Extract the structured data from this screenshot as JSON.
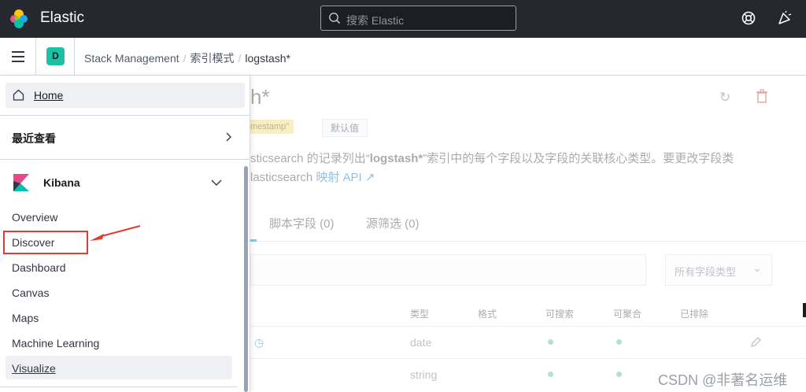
{
  "header": {
    "brand": "Elastic",
    "search_placeholder": "搜索 Elastic"
  },
  "breadcrumbs": {
    "space_initial": "D",
    "items": [
      "Stack Management",
      "索引模式",
      "logstash*"
    ]
  },
  "nav": {
    "home": "Home",
    "recent": "最近查看",
    "section": "Kibana",
    "items": [
      "Overview",
      "Discover",
      "Dashboard",
      "Canvas",
      "Maps",
      "Machine Learning",
      "Visualize"
    ],
    "active_item": "Visualize"
  },
  "background": {
    "title": "h*",
    "badge_timestamp": "mestamp\"",
    "badge_default": "默认值",
    "desc_line1_a": "sticsearch 的记录列出“",
    "desc_line1_b": "logstash*",
    "desc_line1_c": "”索引中的每个字段以及字段的关联核心类型。要更改字段类",
    "desc_line2_a": "lasticsearch ",
    "desc_line2_link": "映射 API",
    "tab_script": "脚本字段 (0)",
    "tab_source": "源筛选 (0)",
    "type_filter": "所有字段类型",
    "columns": [
      "类型",
      "格式",
      "可搜索",
      "可聚合",
      "已排除"
    ],
    "rows": [
      {
        "type": "date"
      },
      {
        "type": "string"
      }
    ]
  },
  "watermark": "CSDN @非著名运维",
  "colors": {
    "header_bg": "#25282f",
    "accent": "#006bb8",
    "highlight": "#e23b34",
    "space_avatar": "#1dbfa7"
  }
}
